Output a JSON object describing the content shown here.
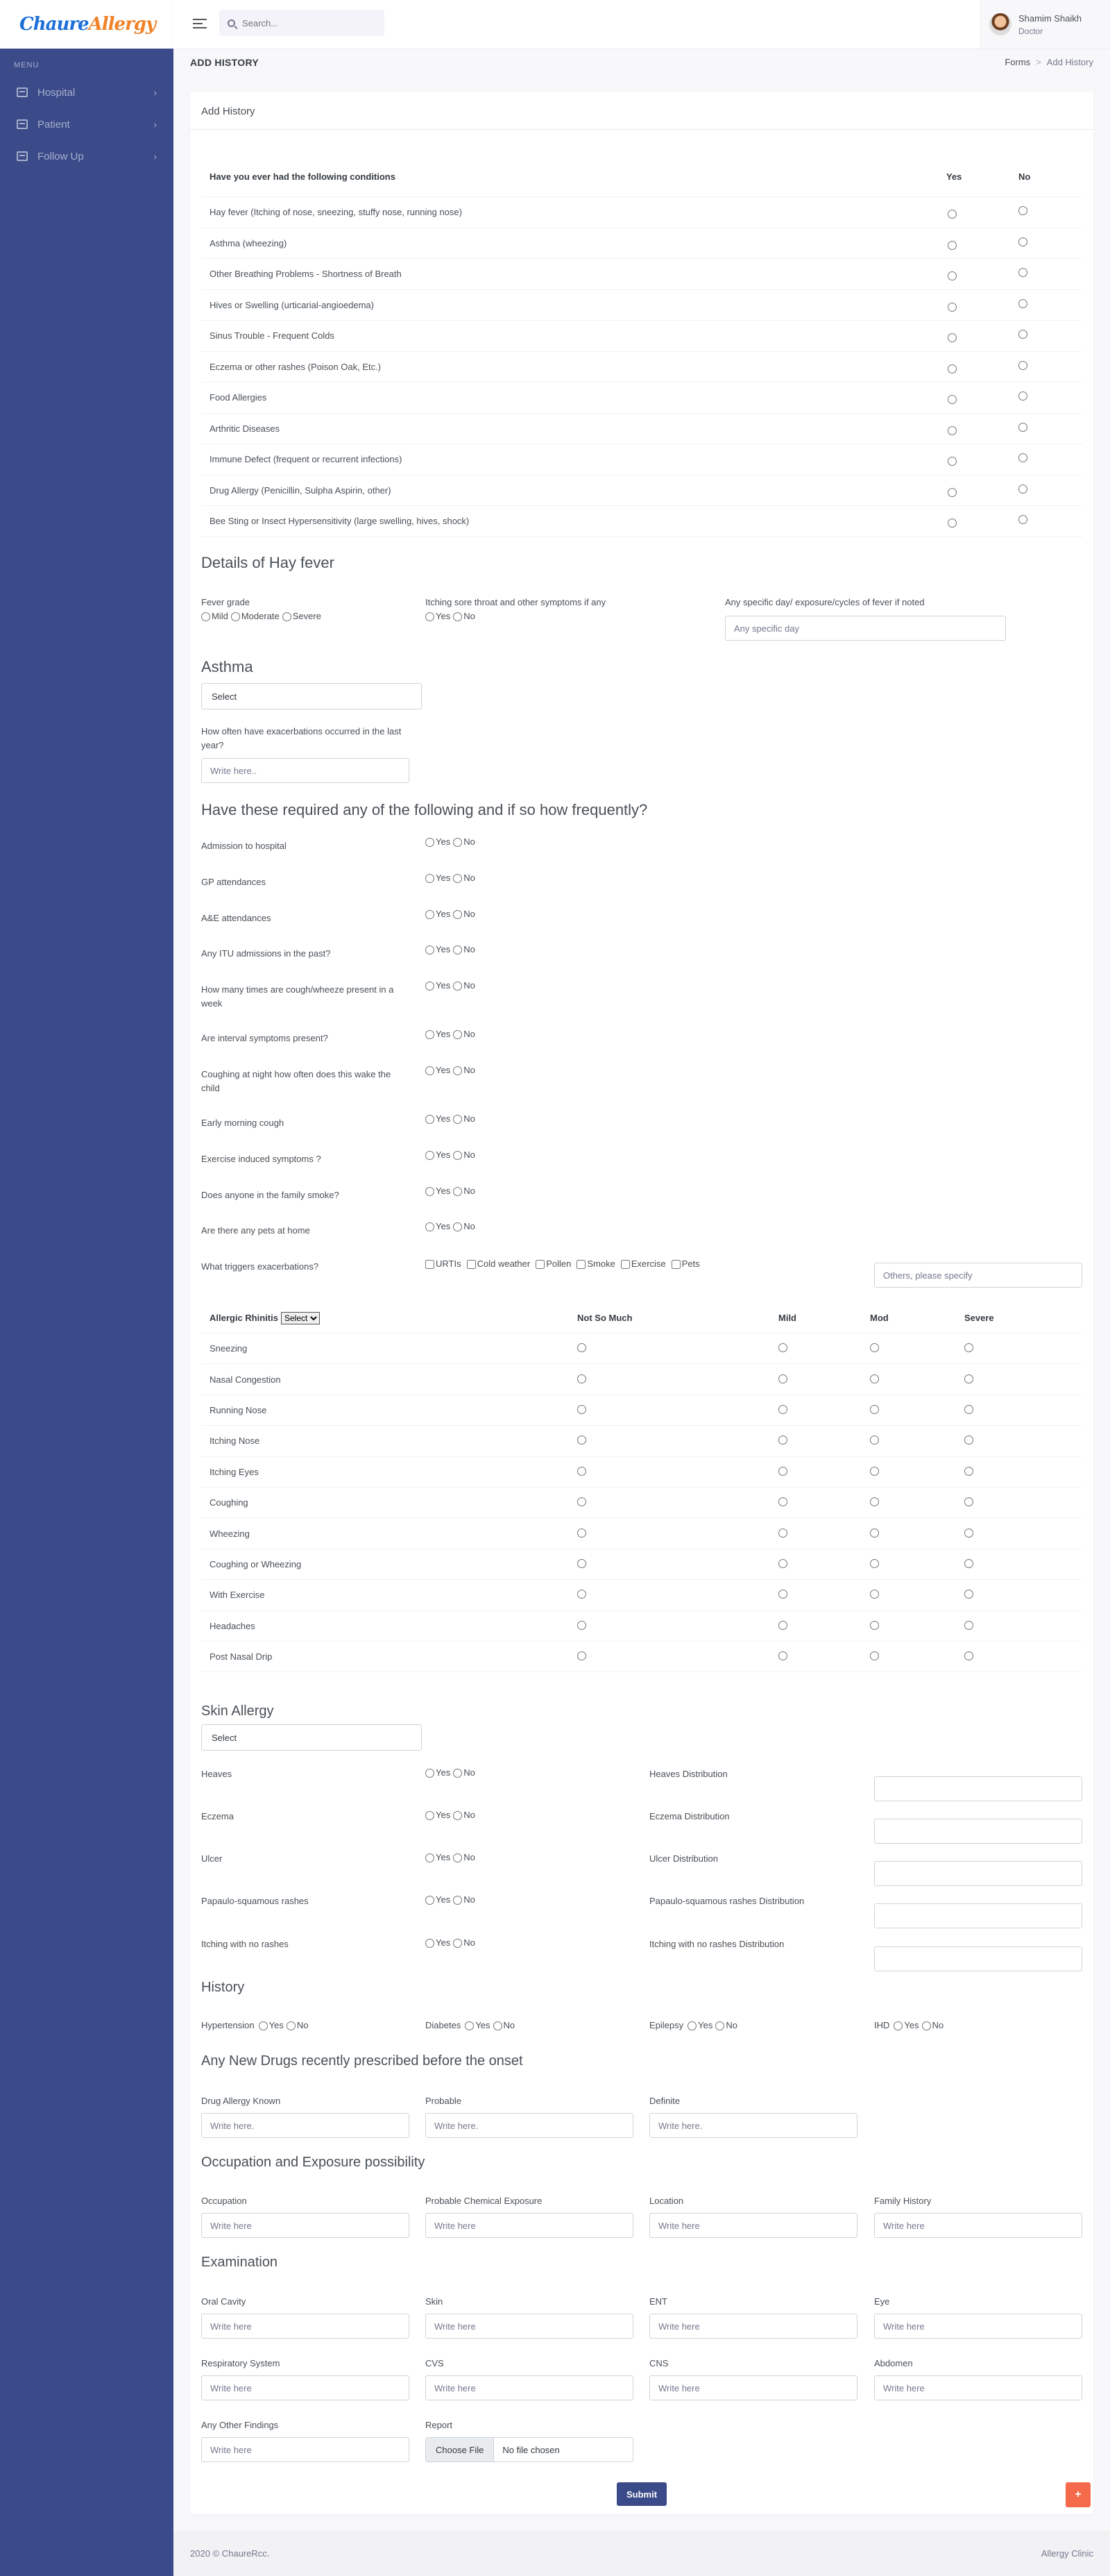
{
  "brand": {
    "part1": "Chaure",
    "part2": "Allergy"
  },
  "sidebar": {
    "menu_title": "MENU",
    "items": [
      {
        "label": "Hospital"
      },
      {
        "label": "Patient"
      },
      {
        "label": "Follow Up"
      }
    ]
  },
  "search": {
    "placeholder": "Search..."
  },
  "user": {
    "name": "Shamim Shaikh",
    "role": "Doctor"
  },
  "page": {
    "title": "ADD HISTORY",
    "breadcrumb": [
      "Forms",
      "Add History"
    ]
  },
  "card": {
    "title": "Add History"
  },
  "conditions": {
    "header": "Have you ever had the following conditions",
    "yes": "Yes",
    "no": "No",
    "items": [
      "Hay fever (Itching of nose, sneezing, stuffy nose, running nose)",
      "Asthma (wheezing)",
      "Other Breathing Problems - Shortness of Breath",
      "Hives or Swelling (urticarial-angioedema)",
      "Sinus Trouble - Frequent Colds",
      "Eczema or other rashes (Poison Oak, Etc.)",
      "Food Allergies",
      "Arthritic Diseases",
      "Immune Defect (frequent or recurrent infections)",
      "Drug Allergy (Penicillin, Sulpha Aspirin, other)",
      "Bee Sting or Insect Hypersensitivity (large swelling, hives, shock)"
    ]
  },
  "hayfever": {
    "title": "Details of Hay fever",
    "fever_grade": "Fever grade",
    "grades": [
      "Mild",
      "Moderate",
      "Severe"
    ],
    "itching": "Itching sore throat and other symptoms if any",
    "yes": "Yes",
    "no": "No",
    "specific": "Any specific day/ exposure/cycles of fever if noted",
    "specific_placeholder": "Any specific day"
  },
  "asthma": {
    "title": "Asthma",
    "select": "Select",
    "often": "How often have exacerbations occurred in the last year?",
    "placeholder": "Write here.."
  },
  "frequency": {
    "title": "Have these required any of the following and if so how frequently?",
    "yes": "Yes",
    "no": "No",
    "items": [
      "Admission to hospital",
      "GP attendances",
      "A&E attendances",
      "Any ITU admissions in the past?",
      "How many times are cough/wheeze present in a week",
      "Are interval symptoms present?",
      "Coughing at night how often does this wake the child",
      "Early morning cough",
      "Exercise induced symptoms ?",
      "Does anyone in the family smoke?",
      "Are there any pets at home"
    ],
    "triggers_label": "What triggers exacerbations?",
    "triggers": [
      "URTIs",
      "Cold weather",
      "Pollen",
      "Smoke",
      "Exercise",
      "Pets"
    ],
    "others_placeholder": "Others, please specify"
  },
  "rhinitis": {
    "header": "Allergic Rhinitis",
    "select": "Select",
    "cols": [
      "Not So Much",
      "Mild",
      "Mod",
      "Severe"
    ],
    "items": [
      "Sneezing",
      "Nasal Congestion",
      "Running Nose",
      "Itching Nose",
      "Itching Eyes",
      "Coughing",
      "Wheezing",
      "Coughing or Wheezing",
      "With Exercise",
      "Headaches",
      "Post Nasal Drip"
    ]
  },
  "skin": {
    "title": "Skin Allergy",
    "select": "Select",
    "yes": "Yes",
    "no": "No",
    "items": [
      {
        "label": "Heaves",
        "dist": "Heaves Distribution"
      },
      {
        "label": "Eczema",
        "dist": "Eczema Distribution"
      },
      {
        "label": "Ulcer",
        "dist": "Ulcer Distribution"
      },
      {
        "label": "Papaulo-squamous rashes",
        "dist": "Papaulo-squamous rashes Distribution"
      },
      {
        "label": "Itching with no rashes",
        "dist": "Itching with no rashes Distribution"
      }
    ]
  },
  "history": {
    "title": "History",
    "yes": "Yes",
    "no": "No",
    "items": [
      "Hypertension",
      "Diabetes",
      "Epilepsy",
      "IHD"
    ]
  },
  "drugs": {
    "title": "Any New Drugs recently prescribed before the onset",
    "fields": [
      "Drug Allergy Known",
      "Probable",
      "Definite"
    ],
    "placeholder": "Write here."
  },
  "occupation": {
    "title": "Occupation and Exposure possibility",
    "fields": [
      "Occupation",
      "Probable Chemical Exposure",
      "Location",
      "Family History"
    ],
    "placeholder": "Write here"
  },
  "exam": {
    "title": "Examination",
    "fields": [
      "Oral Cavity",
      "Skin",
      "ENT",
      "Eye",
      "Respiratory System",
      "CVS",
      "CNS",
      "Abdomen",
      "Any Other Findings"
    ],
    "placeholder": "Write here",
    "report": "Report",
    "choose": "Choose File",
    "nofile": "No file chosen"
  },
  "buttons": {
    "submit": "Submit",
    "plus": "+"
  },
  "footer": {
    "left": "2020 © ChaureRcc.",
    "right": "Allergy Clinic"
  },
  "colors": {
    "sidebar": "#3b4a88",
    "submit": "#3b4a88",
    "plus": "#f46a4b"
  }
}
